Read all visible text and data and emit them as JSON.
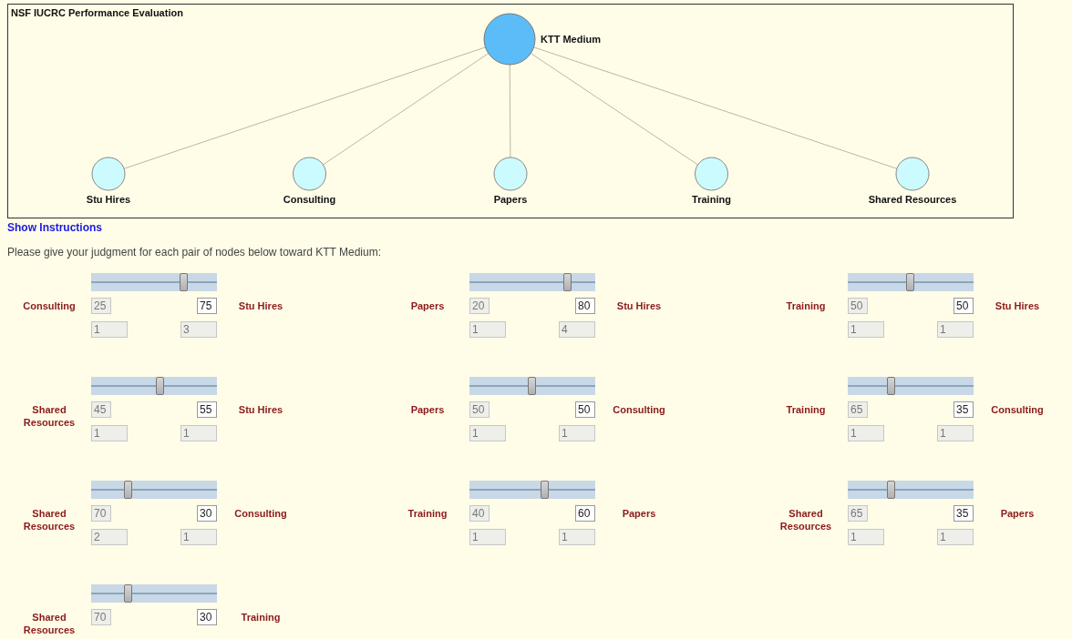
{
  "diagram": {
    "title": "NSF IUCRC Performance Evaluation",
    "goal": "KTT Medium",
    "nodes": [
      "Stu Hires",
      "Consulting",
      "Papers",
      "Training",
      "Shared Resources"
    ]
  },
  "instructions_link": "Show Instructions",
  "prompt": "Please give your judgment for each pair of nodes below toward KTT Medium:",
  "comparisons": [
    {
      "left": "Consulting",
      "right": "Stu Hires",
      "level": 0.74,
      "left_value": "25",
      "right_value": "75",
      "left_ratio": "1",
      "right_ratio": "3"
    },
    {
      "left": "Papers",
      "right": "Stu Hires",
      "level": 0.78,
      "left_value": "20",
      "right_value": "80",
      "left_ratio": "1",
      "right_ratio": "4"
    },
    {
      "left": "Training",
      "right": "Stu Hires",
      "level": 0.5,
      "left_value": "50",
      "right_value": "50",
      "left_ratio": "1",
      "right_ratio": "1"
    },
    {
      "left": "Shared Resources",
      "right": "Stu Hires",
      "level": 0.55,
      "left_value": "45",
      "right_value": "55",
      "left_ratio": "1",
      "right_ratio": "1"
    },
    {
      "left": "Papers",
      "right": "Consulting",
      "level": 0.5,
      "left_value": "50",
      "right_value": "50",
      "left_ratio": "1",
      "right_ratio": "1"
    },
    {
      "left": "Training",
      "right": "Consulting",
      "level": 0.35,
      "left_value": "65",
      "right_value": "35",
      "left_ratio": "1",
      "right_ratio": "1"
    },
    {
      "left": "Shared Resources",
      "right": "Consulting",
      "level": 0.3,
      "left_value": "70",
      "right_value": "30",
      "left_ratio": "2",
      "right_ratio": "1"
    },
    {
      "left": "Training",
      "right": "Papers",
      "level": 0.6,
      "left_value": "40",
      "right_value": "60",
      "left_ratio": "1",
      "right_ratio": "1"
    },
    {
      "left": "Shared Resources",
      "right": "Papers",
      "level": 0.35,
      "left_value": "65",
      "right_value": "35",
      "left_ratio": "1",
      "right_ratio": "1"
    },
    {
      "left": "Shared Resources",
      "right": "Training",
      "level": 0.3,
      "left_value": "70",
      "right_value": "30"
    }
  ]
}
